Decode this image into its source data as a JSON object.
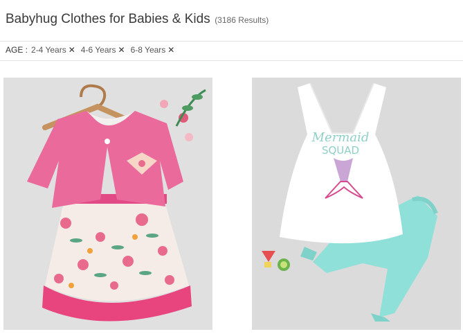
{
  "header": {
    "title": "Babyhug Clothes for Babies & Kids",
    "results": "(3186 Results)"
  },
  "filters": {
    "label": "AGE :",
    "chips": [
      {
        "label": "2-4 Years",
        "remove_icon": "close-icon"
      },
      {
        "label": "4-6 Years",
        "remove_icon": "close-icon"
      },
      {
        "label": "6-8 Years",
        "remove_icon": "close-icon"
      }
    ]
  },
  "products": [
    {
      "image": "pink-floral-frock-with-shrug",
      "accent": "#e85a8c"
    },
    {
      "image": "mermaid-squad-top-and-aqua-capri",
      "accent": "#7fdcd4",
      "print_text": [
        "Mermaid",
        "SQUAD"
      ]
    }
  ]
}
